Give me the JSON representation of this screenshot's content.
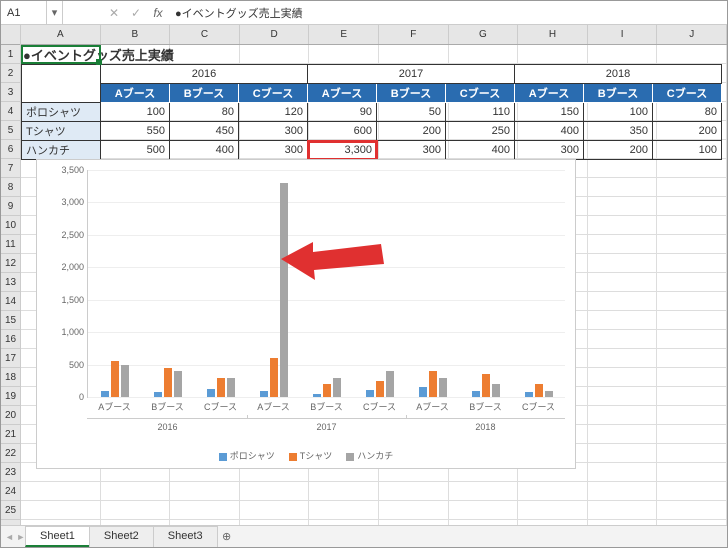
{
  "formula_bar": {
    "cell_ref": "A1",
    "cancel": "✕",
    "confirm": "✓",
    "fx": "fx",
    "value": "●イベントグッズ売上実績"
  },
  "columns": [
    "A",
    "B",
    "C",
    "D",
    "E",
    "F",
    "G",
    "H",
    "I",
    "J"
  ],
  "row_count": 26,
  "table": {
    "title": "●イベントグッズ売上実績",
    "years": [
      "2016",
      "2017",
      "2018"
    ],
    "booths": [
      "Aブース",
      "Bブース",
      "Cブース"
    ],
    "row_labels": [
      "ポロシャツ",
      "Tシャツ",
      "ハンカチ"
    ],
    "rows": [
      [
        "100",
        "80",
        "120",
        "90",
        "50",
        "110",
        "150",
        "100",
        "80"
      ],
      [
        "550",
        "450",
        "300",
        "600",
        "200",
        "250",
        "400",
        "350",
        "200"
      ],
      [
        "500",
        "400",
        "300",
        "3,300",
        "300",
        "400",
        "300",
        "200",
        "100"
      ]
    ],
    "highlight": {
      "row": 2,
      "col": 3
    }
  },
  "chart_data": {
    "type": "bar",
    "title": "",
    "xlabel": "",
    "ylabel": "",
    "ylim": [
      0,
      3500
    ],
    "yticks": [
      "0",
      "500",
      "1,000",
      "1,500",
      "2,000",
      "2,500",
      "3,000",
      "3,500"
    ],
    "groups": [
      "2016",
      "2017",
      "2018"
    ],
    "categories": [
      "Aブース",
      "Bブース",
      "Cブース",
      "Aブース",
      "Bブース",
      "Cブース",
      "Aブース",
      "Bブース",
      "Cブース"
    ],
    "series": [
      {
        "name": "ポロシャツ",
        "color": "#5b9bd5",
        "values": [
          100,
          80,
          120,
          90,
          50,
          110,
          150,
          100,
          80
        ]
      },
      {
        "name": "Tシャツ",
        "color": "#ed7d31",
        "values": [
          550,
          450,
          300,
          600,
          200,
          250,
          400,
          350,
          200
        ]
      },
      {
        "name": "ハンカチ",
        "color": "#a5a5a5",
        "values": [
          500,
          400,
          300,
          3300,
          300,
          400,
          300,
          200,
          100
        ]
      }
    ]
  },
  "tabs": {
    "items": [
      "Sheet1",
      "Sheet2",
      "Sheet3"
    ],
    "active": 0
  }
}
